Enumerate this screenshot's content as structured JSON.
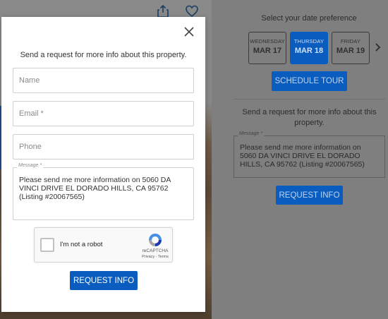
{
  "header_icons": {
    "share": "share-icon",
    "favorite": "heart-icon"
  },
  "background_panel": {
    "date_preference_label": "Select your date preference",
    "dates": [
      {
        "day": "WEDNESDAY",
        "date": "MAR 17",
        "selected": false
      },
      {
        "day": "THURSDAY",
        "date": "MAR 18",
        "selected": true
      },
      {
        "day": "FRIDAY",
        "date": "MAR 19",
        "selected": false
      }
    ],
    "next_dates_icon": "chevron-right-icon",
    "schedule_tour_label": "SCHEDULE TOUR",
    "request_text": "Send a request for more info about this property.",
    "message_label": "Message *",
    "message_value": "Please send me more information on 5060 DA VINCI DRIVE EL DORADO HILLS, CA 95762 (Listing #20067565)",
    "request_info_label": "REQUEST INFO"
  },
  "modal": {
    "close_icon": "close-icon",
    "intro": "Send a request for more info about this property.",
    "name_placeholder": "Name",
    "email_placeholder": "Email *",
    "phone_placeholder": "Phone",
    "message_label": "Message *",
    "message_value": "Please send me more information on 5060 DA VINCI DRIVE EL DORADO HILLS, CA 95762 (Listing #20067565)",
    "recaptcha": {
      "label": "I'm not a robot",
      "brand": "reCAPTCHA",
      "links": "Privacy - Terms"
    },
    "submit_label": "REQUEST INFO"
  },
  "colors": {
    "accent_blue": "#0a5dbf",
    "overlay_gray": "#7f7f7f"
  }
}
